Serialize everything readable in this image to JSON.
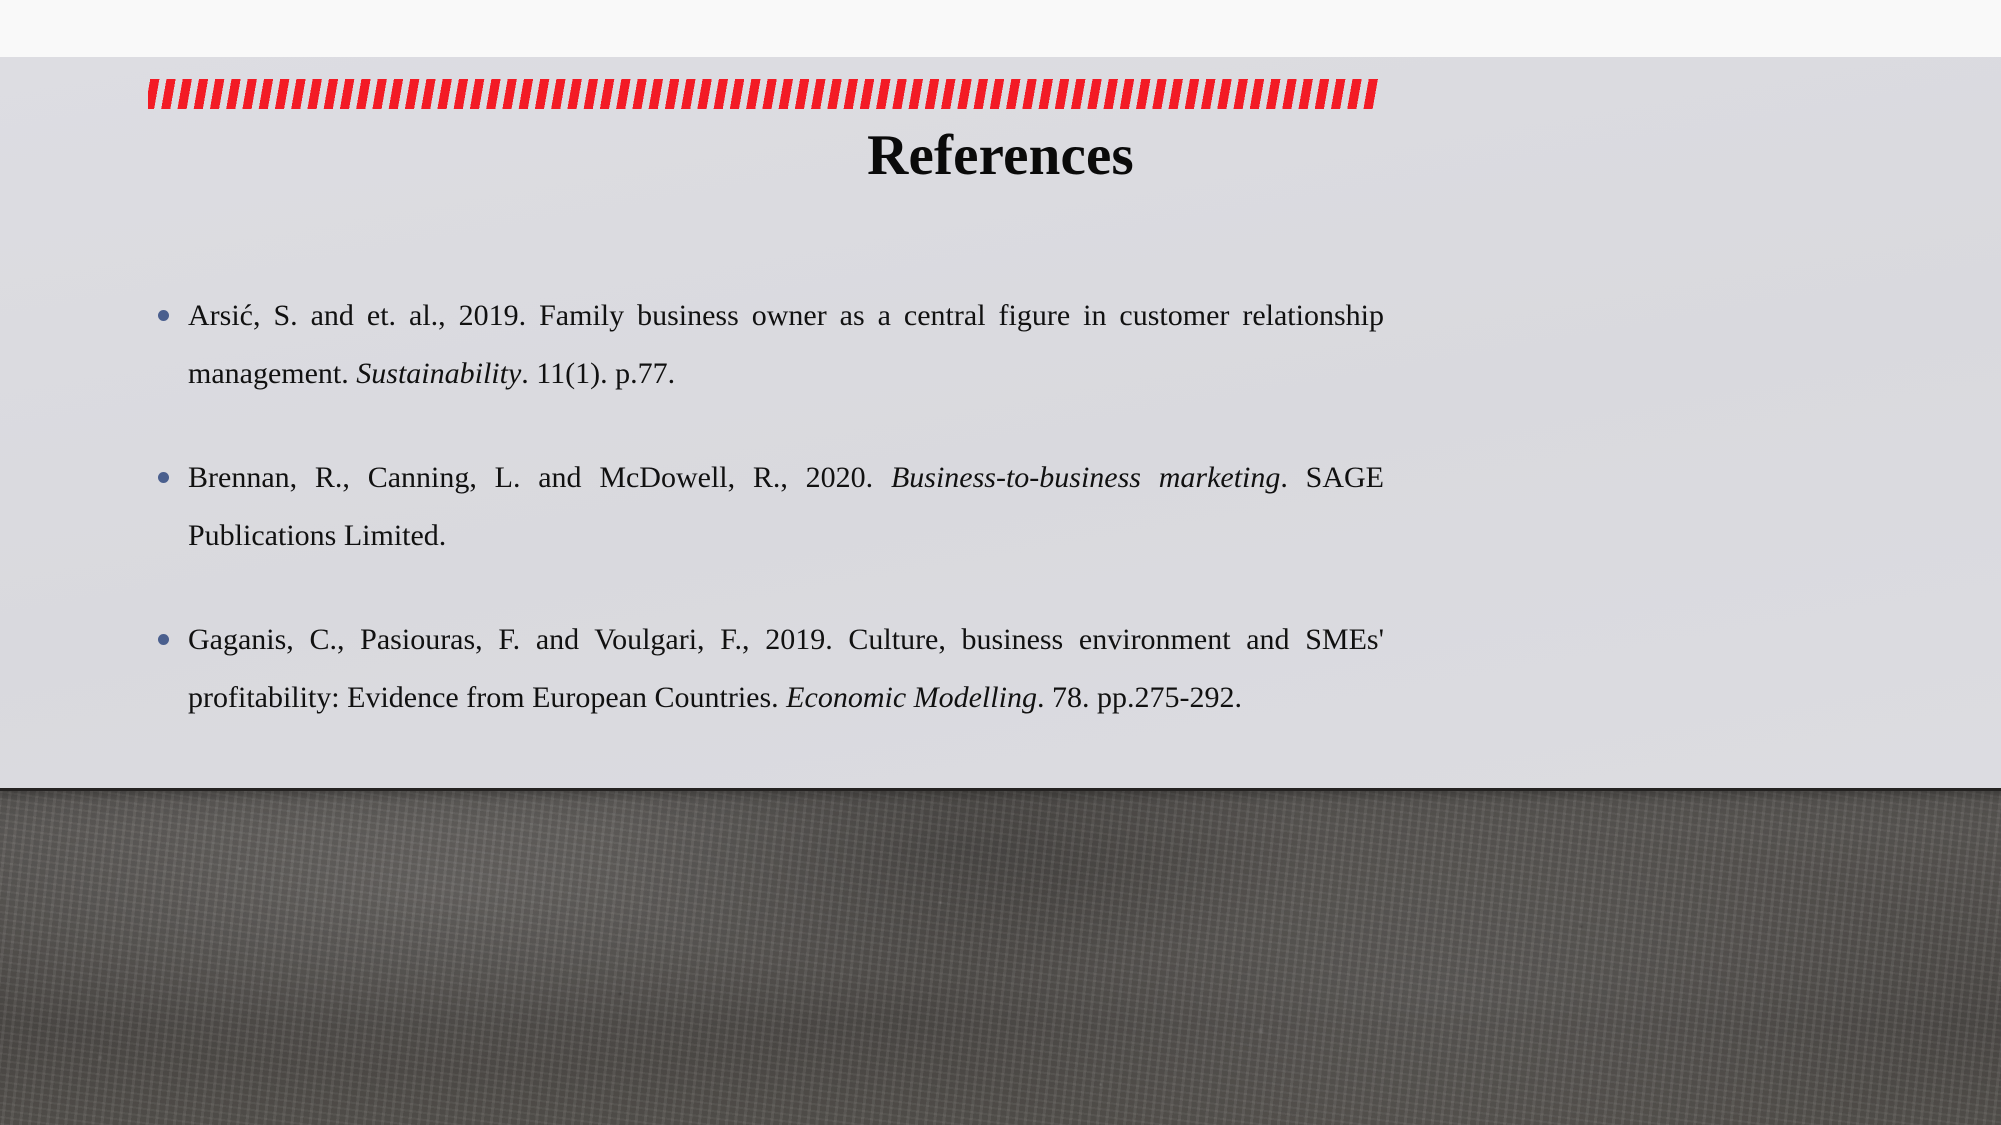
{
  "slide": {
    "title": "References",
    "accent_color": "#f31b25",
    "background_color": "#dcdce1",
    "bullet_color": "#4a5f8e",
    "title_color": "#0a0a0a",
    "footer_color": "#55524f"
  },
  "references": [
    {
      "id": "reference-arsic",
      "parts": [
        {
          "text": "Arsić, S. and et. al., 2019. Family business owner as a central figure in customer relationship management. ",
          "style": "normal"
        },
        {
          "text": "Sustainability",
          "style": "italic"
        },
        {
          "text": ". 11(1). p.77.",
          "style": "normal"
        }
      ]
    },
    {
      "id": "reference-brennan",
      "parts": [
        {
          "text": "Brennan, R., Canning, L. and McDowell, R., 2020. ",
          "style": "normal"
        },
        {
          "text": "Business-to-business marketing",
          "style": "italic"
        },
        {
          "text": ". SAGE Publications Limited.",
          "style": "normal"
        }
      ]
    },
    {
      "id": "reference-gaganis",
      "parts": [
        {
          "text": "Gaganis, C., Pasiouras, F. and Voulgari, F., 2019. Culture, business environment and SMEs' profitability: Evidence from European Countries. ",
          "style": "normal"
        },
        {
          "text": "Economic Modelling",
          "style": "italic"
        },
        {
          "text": ". 78. pp.275-292.",
          "style": "normal"
        }
      ]
    }
  ]
}
